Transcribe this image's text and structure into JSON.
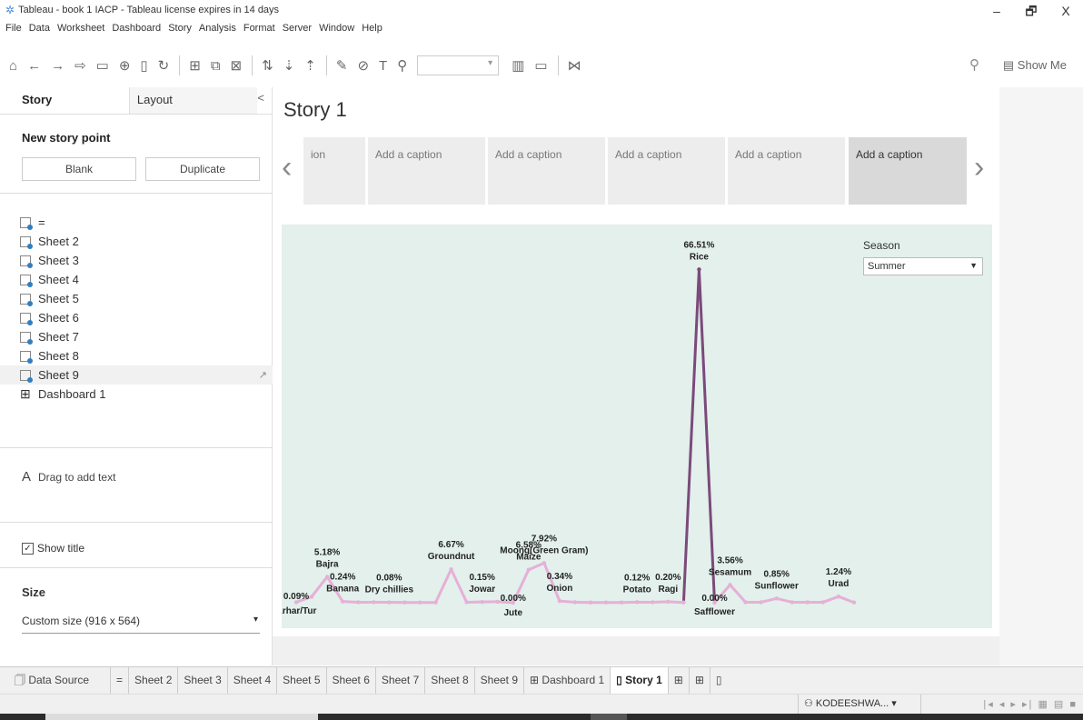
{
  "window": {
    "title": "Tableau - book 1 IACP - Tableau license expires in 14 days",
    "min": "–",
    "max": "🗗",
    "close": "X"
  },
  "menu": [
    "File",
    "Data",
    "Worksheet",
    "Dashboard",
    "Story",
    "Analysis",
    "Format",
    "Server",
    "Window",
    "Help"
  ],
  "toolbar": {
    "show_me": "Show Me"
  },
  "left_panel": {
    "tab_story": "Story",
    "tab_layout": "Layout",
    "collapse": "<",
    "new_story_point": "New story point",
    "blank_label": "Blank",
    "duplicate_label": "Duplicate",
    "sheets": [
      "=",
      "Sheet 2",
      "Sheet 3",
      "Sheet 4",
      "Sheet 5",
      "Sheet 6",
      "Sheet 7",
      "Sheet 8",
      "Sheet 9"
    ],
    "dashboard": "Dashboard 1",
    "drag_text": "Drag to add text",
    "show_title": "Show title",
    "size_title": "Size",
    "size_value": "Custom size (916 x 564)"
  },
  "story": {
    "title": "Story 1",
    "captions": [
      "ion",
      "Add a caption",
      "Add a caption",
      "Add a caption",
      "Add a caption",
      "Add a caption"
    ]
  },
  "filter": {
    "label": "Season",
    "value": "Summer"
  },
  "chart_data": {
    "type": "line",
    "title": "",
    "xlabel": "",
    "ylabel": "",
    "ylim": [
      0,
      70
    ],
    "grid": false,
    "color": "#e6b0d6",
    "highlight_color": "#7b4a7a",
    "points": [
      {
        "label": "Arhar/Tur",
        "value": 0.09,
        "text": "0.09%"
      },
      {
        "label": "",
        "value": 1.2
      },
      {
        "label": "Bajra",
        "value": 5.18,
        "text": "5.18%"
      },
      {
        "label": "Banana",
        "value": 0.24,
        "text": "0.24%"
      },
      {
        "label": "",
        "value": 0.1
      },
      {
        "label": "",
        "value": 0.1
      },
      {
        "label": "Dry chillies",
        "value": 0.08,
        "text": "0.08%"
      },
      {
        "label": "",
        "value": 0.05
      },
      {
        "label": "",
        "value": 0.05
      },
      {
        "label": "",
        "value": 0.05
      },
      {
        "label": "Groundnut",
        "value": 6.67,
        "text": "6.67%"
      },
      {
        "label": "",
        "value": 0.1
      },
      {
        "label": "Jowar",
        "value": 0.15,
        "text": "0.15%"
      },
      {
        "label": "",
        "value": 0.2
      },
      {
        "label": "Jute",
        "value": 0.0,
        "text": "0.00%"
      },
      {
        "label": "Maize",
        "value": 6.58,
        "text": "6.58%"
      },
      {
        "label": "Moong(Green Gram)",
        "value": 7.92,
        "text": "7.92%"
      },
      {
        "label": "Onion",
        "value": 0.34,
        "text": "0.34%"
      },
      {
        "label": "",
        "value": 0.1
      },
      {
        "label": "",
        "value": 0.05
      },
      {
        "label": "",
        "value": 0.05
      },
      {
        "label": "",
        "value": 0.05
      },
      {
        "label": "Potato",
        "value": 0.12,
        "text": "0.12%"
      },
      {
        "label": "",
        "value": 0.1
      },
      {
        "label": "Ragi",
        "value": 0.2,
        "text": "0.20%"
      },
      {
        "label": "",
        "value": 0.05
      },
      {
        "label": "Rice",
        "value": 66.51,
        "text": "66.51%"
      },
      {
        "label": "Safflower",
        "value": 0.0,
        "text": "0.00%"
      },
      {
        "label": "Sesamum",
        "value": 3.56,
        "text": "3.56%"
      },
      {
        "label": "",
        "value": 0.1
      },
      {
        "label": "",
        "value": 0.1
      },
      {
        "label": "Sunflower",
        "value": 0.85,
        "text": "0.85%"
      },
      {
        "label": "",
        "value": 0.1
      },
      {
        "label": "",
        "value": 0.1
      },
      {
        "label": "",
        "value": 0.1
      },
      {
        "label": "Urad",
        "value": 1.24,
        "text": "1.24%"
      },
      {
        "label": "",
        "value": 0.05
      }
    ]
  },
  "sheet_tabs": [
    "Data Source",
    "=",
    "Sheet 2",
    "Sheet 3",
    "Sheet 4",
    "Sheet 5",
    "Sheet 6",
    "Sheet 7",
    "Sheet 8",
    "Sheet 9",
    "Dashboard 1",
    "Story 1"
  ],
  "status": {
    "user": "KODEESHWA..."
  }
}
